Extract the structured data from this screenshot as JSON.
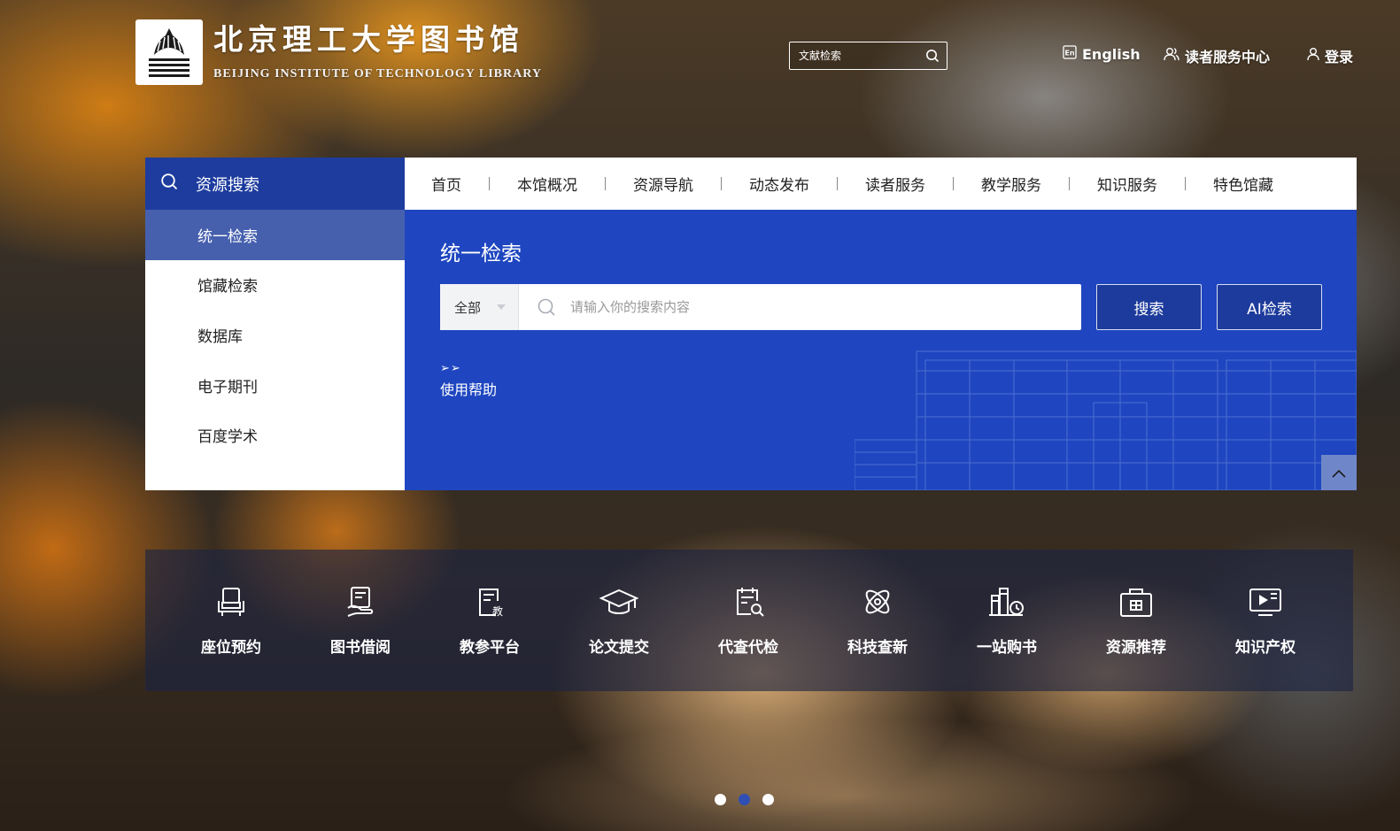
{
  "header": {
    "logo_cn": "北京理工大学图书馆",
    "logo_en": "BEIJING INSTITUTE OF TECHNOLOGY LIBRARY",
    "search_placeholder": "文献检索",
    "links": {
      "english": "English",
      "reader_center": "读者服务中心",
      "login": "登录"
    }
  },
  "sidebar": {
    "title": "资源搜索",
    "items": [
      {
        "label": "统一检索",
        "active": true
      },
      {
        "label": "馆藏检索"
      },
      {
        "label": "数据库"
      },
      {
        "label": "电子期刊"
      },
      {
        "label": "百度学术"
      }
    ]
  },
  "nav": {
    "items": [
      "首页",
      "本馆概况",
      "资源导航",
      "动态发布",
      "读者服务",
      "教学服务",
      "知识服务",
      "特色馆藏"
    ]
  },
  "search_panel": {
    "title": "统一检索",
    "scope": "全部",
    "placeholder": "请输入你的搜索内容",
    "search_button": "搜索",
    "ai_button": "AI检索",
    "help_arrows": "➢➢",
    "help_label": "使用帮助"
  },
  "services": [
    {
      "label": "座位预约",
      "icon": "seat-icon"
    },
    {
      "label": "图书借阅",
      "icon": "book-borrow-icon"
    },
    {
      "label": "教参平台",
      "icon": "teaching-ref-icon"
    },
    {
      "label": "论文提交",
      "icon": "graduation-cap-icon"
    },
    {
      "label": "代查代检",
      "icon": "search-document-icon"
    },
    {
      "label": "科技查新",
      "icon": "atom-icon"
    },
    {
      "label": "一站购书",
      "icon": "book-purchase-icon"
    },
    {
      "label": "资源推荐",
      "icon": "briefcase-icon"
    },
    {
      "label": "知识产权",
      "icon": "presentation-icon"
    }
  ],
  "carousel": {
    "count": 3,
    "active_index": 1
  },
  "colors": {
    "primary_blue": "#1f46c0",
    "dark_blue": "#1d3c9e",
    "active_item": "#4660ae"
  }
}
